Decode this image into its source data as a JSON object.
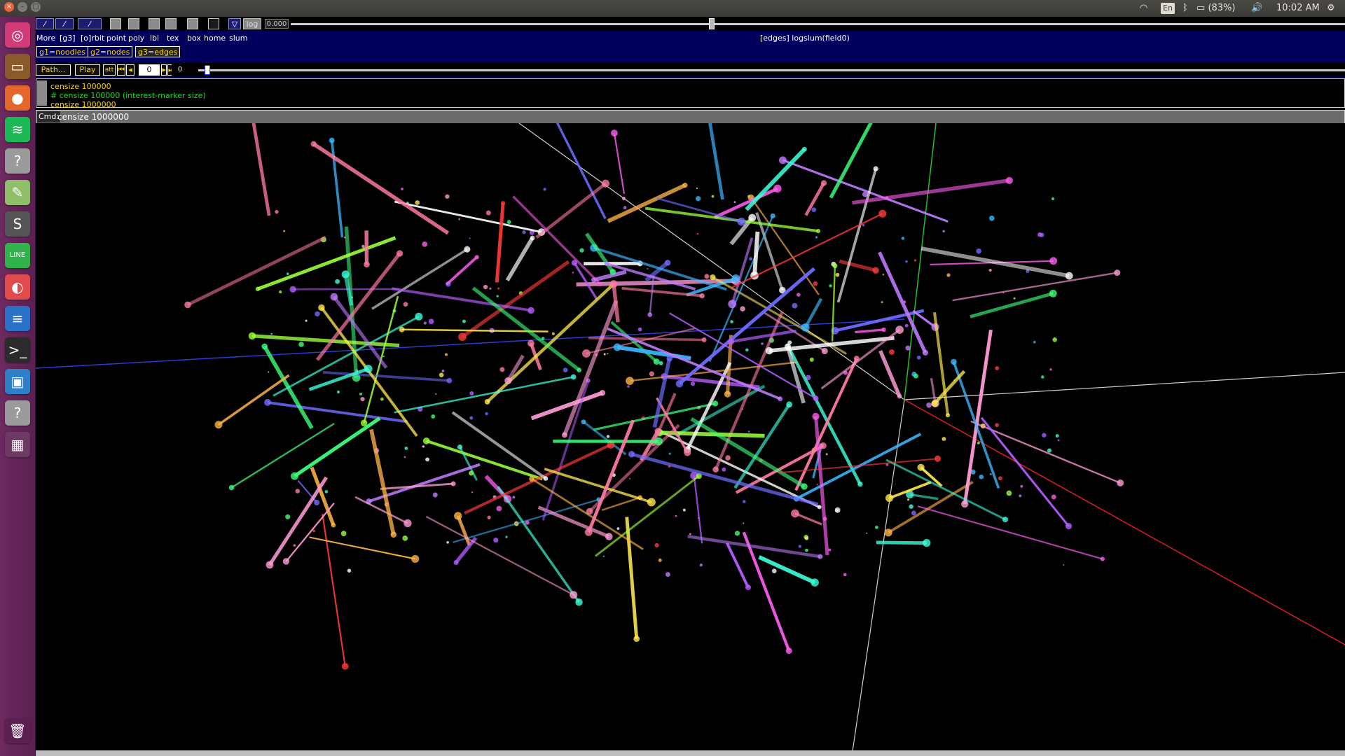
{
  "system_bar": {
    "wifi_icon": "wifi-icon",
    "lang": "En",
    "bluetooth_icon": "bluetooth-icon",
    "battery": "(83%)",
    "volume_icon": "volume-icon",
    "time": "10:02 AM",
    "gear_icon": "gear-icon"
  },
  "launcher": {
    "items": [
      {
        "name": "ubuntu-dash-icon",
        "color": "#d13c78",
        "glyph": "◎"
      },
      {
        "name": "files-icon",
        "color": "#8a5a2a",
        "glyph": "▭"
      },
      {
        "name": "firefox-icon",
        "color": "#e5662b",
        "glyph": "●"
      },
      {
        "name": "spotify-icon",
        "color": "#1db954",
        "glyph": "≋"
      },
      {
        "name": "unknown-app-icon",
        "color": "#9b9b9b",
        "glyph": "?"
      },
      {
        "name": "text-editor-icon",
        "color": "#8fbf6a",
        "glyph": "✎"
      },
      {
        "name": "sublime-icon",
        "color": "#555555",
        "glyph": "S"
      },
      {
        "name": "line-icon",
        "color": "#2fb34a",
        "glyph": "LINE"
      },
      {
        "name": "presentation-icon",
        "color": "#e24b4b",
        "glyph": "◐"
      },
      {
        "name": "writer-icon",
        "color": "#2c71c9",
        "glyph": "≡"
      },
      {
        "name": "terminal-icon",
        "color": "#2b2b2b",
        "glyph": ">_"
      },
      {
        "name": "virtualbox-icon",
        "color": "#2d7fc8",
        "glyph": "▣"
      },
      {
        "name": "unknown-app-2-icon",
        "color": "#9b9b9b",
        "glyph": "?"
      },
      {
        "name": "workspace-switcher-icon",
        "color": "#6d3a63",
        "glyph": "▦"
      },
      {
        "name": "trash-icon",
        "color": "#5b1f50",
        "glyph": "🗑"
      }
    ]
  },
  "toolbar": {
    "num_value": "0.000",
    "log_label": "log",
    "labels": [
      "More",
      "[g3]",
      "[o]rbit",
      "point",
      "poly",
      "lbl",
      "tex",
      "box",
      "home",
      "slum"
    ],
    "status": "[edges] logslum(field0)"
  },
  "groups": [
    "g1=noodles",
    "g2=nodes",
    "g3=edges"
  ],
  "playback": {
    "path_label": "Path...",
    "play_label": "Play",
    "att_label": "att",
    "frame_value": "0",
    "frame_count": "0"
  },
  "console": {
    "lines": [
      "censize 100000",
      "# censize 100000  (interest-marker size)",
      "censize 1000000"
    ],
    "line_colors": [
      "#ffd200",
      "#22d82b",
      "#ffd200"
    ]
  },
  "command": {
    "label": "Cmd:",
    "value": "censize 1000000"
  }
}
